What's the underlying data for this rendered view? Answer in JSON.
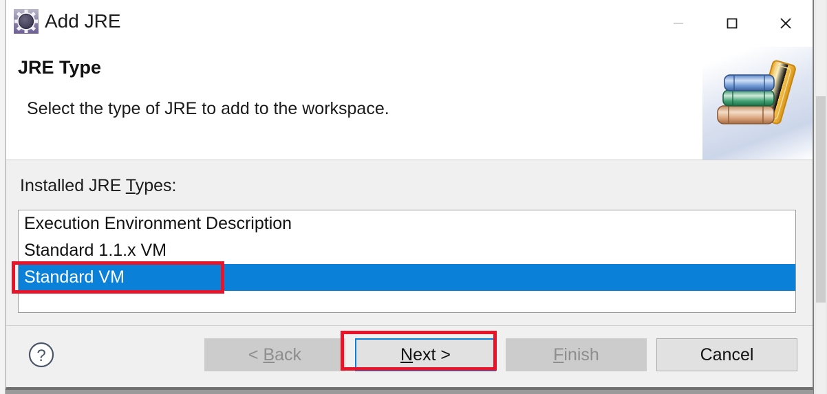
{
  "window": {
    "title": "Add JRE",
    "icon": "jre-gear-icon",
    "controls": [
      {
        "name": "minimize-button",
        "glyph": "minimize",
        "enabled": false
      },
      {
        "name": "maximize-button",
        "glyph": "maximize",
        "enabled": true
      },
      {
        "name": "close-button",
        "glyph": "close",
        "enabled": true
      }
    ]
  },
  "banner": {
    "title": "JRE Type",
    "description": "Select the type of JRE to add to the workspace.",
    "artwork": "stack-of-books-icon"
  },
  "form": {
    "list_label_before": "Installed JRE ",
    "list_label_mnemonic": "T",
    "list_label_after": "ypes:",
    "list_label_full": "Installed JRE Types:",
    "items": [
      {
        "label": "Execution Environment Description",
        "selected": false
      },
      {
        "label": "Standard 1.1.x VM",
        "selected": false
      },
      {
        "label": "Standard VM",
        "selected": true
      }
    ]
  },
  "footer": {
    "help": {
      "name": "help-button",
      "glyph": "?"
    },
    "buttons": [
      {
        "name": "back-button",
        "prefix": "< ",
        "mnemonic": "B",
        "suffix": "ack",
        "label": "< Back",
        "enabled": false,
        "default": false
      },
      {
        "name": "next-button",
        "prefix": "",
        "mnemonic": "N",
        "suffix": "ext >",
        "label": "Next >",
        "enabled": true,
        "default": true
      },
      {
        "name": "finish-button",
        "prefix": "",
        "mnemonic": "F",
        "suffix": "inish",
        "label": "Finish",
        "enabled": false,
        "default": false
      },
      {
        "name": "cancel-button",
        "prefix": "",
        "mnemonic": "",
        "suffix": "Cancel",
        "label": "Cancel",
        "enabled": true,
        "default": false
      }
    ]
  },
  "annotations": [
    {
      "name": "annotation-selected-row",
      "target": "Standard VM",
      "color": "#e8142a"
    },
    {
      "name": "annotation-next-button",
      "target": "Next >",
      "color": "#e8142a"
    }
  ],
  "colors": {
    "selection_blue": "#0a80d8",
    "annotation_red": "#e8142a",
    "dialog_bg": "#f0f0f0",
    "banner_bg": "#ffffff"
  }
}
